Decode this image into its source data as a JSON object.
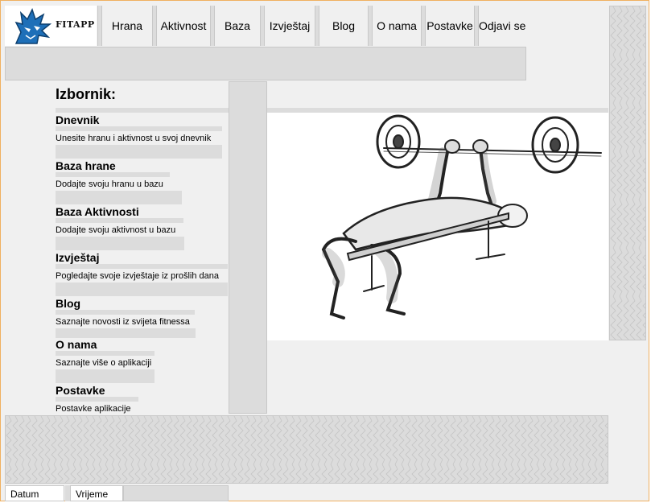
{
  "app": {
    "brand": "FITAPP"
  },
  "nav": {
    "items": [
      {
        "label": "Hrana"
      },
      {
        "label": "Aktivnost"
      },
      {
        "label": "Baza"
      },
      {
        "label": "Izvještaj"
      },
      {
        "label": "Blog"
      },
      {
        "label": "O nama"
      },
      {
        "label": "Postavke"
      },
      {
        "label": "Odjavi se"
      }
    ]
  },
  "menu": {
    "title": "Izbornik:",
    "items": [
      {
        "title": "Dnevnik",
        "desc": "Unesite hranu i aktivnost u svoj dnevnik"
      },
      {
        "title": "Baza hrane",
        "desc": "Dodajte svoju hranu u bazu"
      },
      {
        "title": "Baza Aktivnosti",
        "desc": "Dodajte svoju aktivnost u bazu"
      },
      {
        "title": "Izvještaj",
        "desc": "Pogledajte svoje izvještaje iz prošlih dana"
      },
      {
        "title": "Blog",
        "desc": "Saznajte novosti iz svijeta fitnessa"
      },
      {
        "title": "O nama",
        "desc": "Saznajte više o aplikaciji"
      },
      {
        "title": "Postavke",
        "desc": "Postavke aplikacije"
      }
    ]
  },
  "status": {
    "date": "Datum",
    "time": "Vrijeme"
  },
  "icons": {
    "logo": "wolf-logo-icon",
    "hero": "bench-press-illustration"
  }
}
